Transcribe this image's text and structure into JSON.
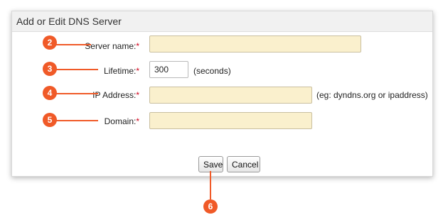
{
  "dialog": {
    "title": "Add or Edit DNS Server"
  },
  "form": {
    "server_name": {
      "label": "Server name:",
      "required_mark": "*",
      "value": ""
    },
    "lifetime": {
      "label": "Lifetime:",
      "required_mark": "*",
      "value": "300",
      "unit": "(seconds)"
    },
    "ip_address": {
      "label": "IP Address:",
      "required_mark": "*",
      "value": "",
      "hint": "(eg: dyndns.org or ipaddress)"
    },
    "domain": {
      "label": "Domain:",
      "required_mark": "*",
      "value": ""
    }
  },
  "buttons": {
    "save_label": "Save",
    "cancel_label": "Cancel"
  },
  "callouts": [
    "2",
    "3",
    "4",
    "5",
    "6"
  ],
  "colors": {
    "callout": "#f05a28",
    "required": "#d0021b",
    "input_highlight": "#faf0cd"
  }
}
